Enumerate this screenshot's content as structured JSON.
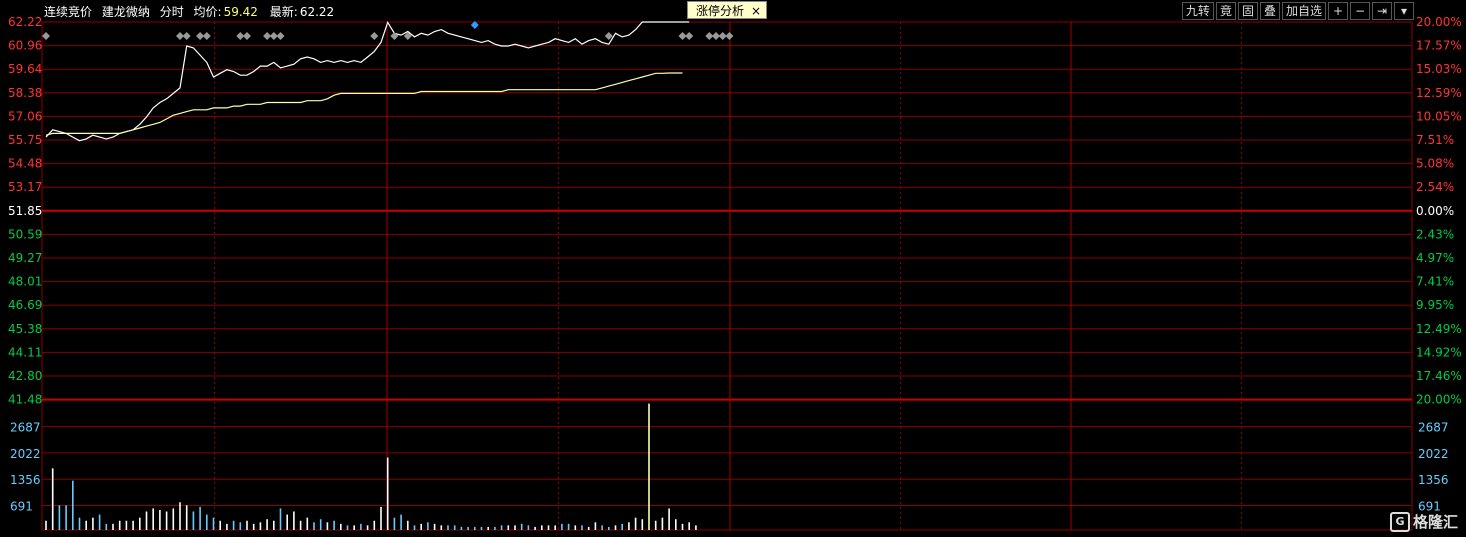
{
  "header": {
    "mode": "连续竞价",
    "stock_name": "建龙微纳",
    "view": "分时",
    "avg_label": "均价:",
    "avg_value": "59.42",
    "last_label": "最新:",
    "last_value": "62.22"
  },
  "tab": {
    "label": "涨停分析",
    "close": "×"
  },
  "toolbar": {
    "jiuzhuan": "九转",
    "jing": "竟",
    "gu": "固",
    "die": "叠",
    "add_watch": "加自选",
    "plus": "+",
    "minus": "−",
    "end": "⇥",
    "menu": "▾"
  },
  "logo": {
    "text": "格隆汇",
    "mark": "G"
  },
  "colors": {
    "up": "#ff3333",
    "down": "#00cc44",
    "flat": "#ffffff",
    "grid": "#8b0000",
    "price_line": "#ffffff",
    "avg_line": "#ffffaa",
    "volume": "#66ccff",
    "marker": "#999999",
    "marker_hl": "#3399ff"
  },
  "chart_data": {
    "type": "line",
    "prev_close": 51.85,
    "price_ticks": [
      "62.22",
      "60.96",
      "59.64",
      "58.38",
      "57.06",
      "55.75",
      "54.48",
      "53.17",
      "51.85",
      "50.59",
      "49.27",
      "48.01",
      "46.69",
      "45.38",
      "44.11",
      "42.80",
      "41.48"
    ],
    "pct_ticks": [
      "20.00%",
      "17.57%",
      "15.03%",
      "12.59%",
      "10.05%",
      "7.51%",
      "5.08%",
      "2.54%",
      "0.00%",
      "2.43%",
      "4.97%",
      "7.41%",
      "9.95%",
      "12.49%",
      "14.92%",
      "17.46%",
      "20.00%"
    ],
    "volume_ticks": [
      "2687",
      "2022",
      "1356",
      "691"
    ],
    "ylim": [
      41.48,
      62.22
    ],
    "price_series": [
      55.9,
      56.3,
      56.2,
      56.1,
      55.9,
      55.7,
      55.8,
      56.0,
      55.9,
      55.8,
      55.9,
      56.1,
      56.2,
      56.3,
      56.6,
      57.0,
      57.5,
      57.8,
      58.0,
      58.3,
      58.6,
      60.9,
      60.8,
      60.4,
      60.0,
      59.2,
      59.4,
      59.6,
      59.5,
      59.3,
      59.3,
      59.5,
      59.8,
      59.8,
      60.0,
      59.7,
      59.8,
      59.9,
      60.2,
      60.3,
      60.2,
      60.0,
      60.1,
      60.0,
      60.1,
      60.0,
      60.1,
      60.0,
      60.3,
      60.6,
      61.1,
      62.2,
      61.6,
      61.5,
      61.7,
      61.4,
      61.6,
      61.5,
      61.7,
      61.8,
      61.6,
      61.5,
      61.4,
      61.3,
      61.2,
      61.1,
      61.2,
      61.0,
      60.9,
      60.9,
      61.0,
      60.9,
      60.8,
      60.9,
      61.0,
      61.1,
      61.3,
      61.2,
      61.1,
      61.3,
      61.0,
      61.2,
      61.3,
      61.1,
      61.0,
      61.6,
      61.4,
      61.5,
      61.8,
      62.22,
      62.22,
      62.22,
      62.22,
      62.22,
      62.22,
      62.22,
      62.22
    ],
    "avg_series": [
      56.0,
      56.1,
      56.1,
      56.1,
      56.1,
      56.1,
      56.1,
      56.1,
      56.1,
      56.1,
      56.1,
      56.1,
      56.2,
      56.3,
      56.4,
      56.5,
      56.6,
      56.7,
      56.9,
      57.1,
      57.2,
      57.3,
      57.4,
      57.4,
      57.4,
      57.5,
      57.5,
      57.5,
      57.6,
      57.6,
      57.7,
      57.7,
      57.7,
      57.8,
      57.8,
      57.8,
      57.8,
      57.8,
      57.8,
      57.9,
      57.9,
      57.9,
      58.0,
      58.2,
      58.3,
      58.3,
      58.3,
      58.3,
      58.3,
      58.3,
      58.3,
      58.3,
      58.3,
      58.3,
      58.3,
      58.3,
      58.4,
      58.4,
      58.4,
      58.4,
      58.4,
      58.4,
      58.4,
      58.4,
      58.4,
      58.4,
      58.4,
      58.4,
      58.4,
      58.5,
      58.5,
      58.5,
      58.5,
      58.5,
      58.5,
      58.5,
      58.5,
      58.5,
      58.5,
      58.5,
      58.5,
      58.5,
      58.5,
      58.6,
      58.7,
      58.8,
      58.9,
      59.0,
      59.1,
      59.2,
      59.3,
      59.4,
      59.4,
      59.42,
      59.42,
      59.42
    ],
    "volume_series": [
      300,
      2000,
      800,
      800,
      1600,
      400,
      300,
      400,
      500,
      200,
      200,
      300,
      300,
      300,
      400,
      600,
      700,
      650,
      600,
      700,
      900,
      800,
      600,
      750,
      500,
      400,
      300,
      200,
      300,
      250,
      300,
      200,
      250,
      350,
      300,
      700,
      500,
      600,
      300,
      400,
      250,
      350,
      250,
      300,
      200,
      150,
      150,
      200,
      150,
      300,
      750,
      2350,
      400,
      500,
      300,
      150,
      200,
      250,
      200,
      150,
      150,
      150,
      100,
      100,
      100,
      100,
      100,
      100,
      150,
      150,
      150,
      200,
      150,
      100,
      150,
      150,
      150,
      200,
      200,
      150,
      150,
      100,
      250,
      150,
      100,
      150,
      200,
      250,
      400,
      350,
      4100,
      300,
      400,
      700,
      350,
      200,
      250,
      150
    ],
    "markers": [
      0,
      20,
      21,
      23,
      24,
      29,
      30,
      33,
      34,
      35,
      49,
      52,
      54,
      84,
      95,
      96,
      99,
      100,
      101,
      102
    ],
    "marker_highlight": [
      64
    ]
  }
}
